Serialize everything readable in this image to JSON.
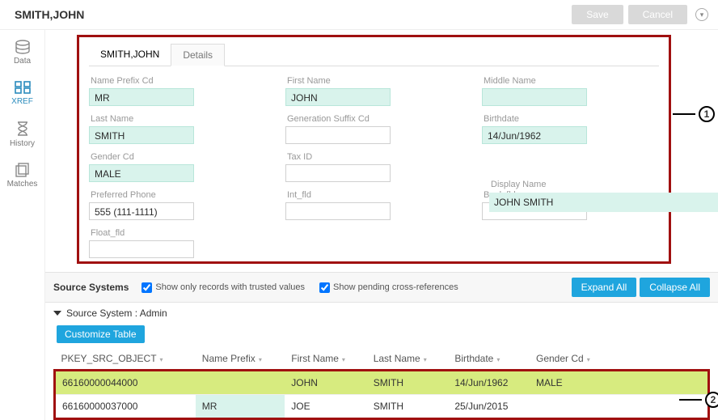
{
  "header": {
    "title": "SMITH,JOHN",
    "save_label": "Save",
    "cancel_label": "Cancel"
  },
  "nav": {
    "items": [
      {
        "key": "data",
        "label": "Data"
      },
      {
        "key": "xref",
        "label": "XREF"
      },
      {
        "key": "history",
        "label": "History"
      },
      {
        "key": "matches",
        "label": "Matches"
      }
    ],
    "active": "xref"
  },
  "tabs": {
    "main": "SMITH,JOHN",
    "details": "Details"
  },
  "form": {
    "name_prefix_cd": {
      "label": "Name Prefix Cd",
      "value": "MR",
      "mint": true
    },
    "first_name": {
      "label": "First Name",
      "value": "JOHN",
      "mint": true
    },
    "middle_name": {
      "label": "Middle Name",
      "value": "",
      "mint": true
    },
    "last_name": {
      "label": "Last Name",
      "value": "SMITH",
      "mint": true
    },
    "generation_suffix_cd": {
      "label": "Generation Suffix Cd",
      "value": "",
      "mint": false
    },
    "birthdate": {
      "label": "Birthdate",
      "value": "14/Jun/1962",
      "mint": true
    },
    "gender_cd": {
      "label": "Gender Cd",
      "value": "MALE",
      "mint": true
    },
    "tax_id": {
      "label": "Tax ID",
      "value": "",
      "mint": false
    },
    "display_name": {
      "label": "Display Name",
      "value": "JOHN SMITH",
      "mint": true
    },
    "preferred_phone": {
      "label": "Preferred Phone",
      "value": "555 (111-1111)",
      "mint": false
    },
    "int_fld": {
      "label": "Int_fld",
      "value": "",
      "mint": false
    },
    "bool_fld": {
      "label": "Bool_fld",
      "value": "",
      "mint": false
    },
    "float_fld": {
      "label": "Float_fld",
      "value": "",
      "mint": false
    }
  },
  "source_bar": {
    "label": "Source Systems",
    "chk_trusted": "Show only records with trusted values",
    "chk_pending": "Show pending cross-references",
    "expand_all": "Expand All",
    "collapse_all": "Collapse All"
  },
  "source_system_row": "Source System : Admin",
  "customize_table": "Customize Table",
  "table": {
    "columns": [
      "PKEY_SRC_OBJECT",
      "Name Prefix",
      "First Name",
      "Last Name",
      "Birthdate",
      "Gender Cd"
    ],
    "rows": [
      {
        "pkey": "66160000044000",
        "prefix": "",
        "first": "JOHN",
        "last": "SMITH",
        "birth": "14/Jun/1962",
        "gender": "MALE",
        "highlight": true
      },
      {
        "pkey": "66160000037000",
        "prefix": "MR",
        "first": "JOE",
        "last": "SMITH",
        "birth": "25/Jun/2015",
        "gender": "",
        "highlight": false,
        "prefix_mint": true
      }
    ]
  },
  "callouts": {
    "one": "1",
    "two": "2"
  }
}
